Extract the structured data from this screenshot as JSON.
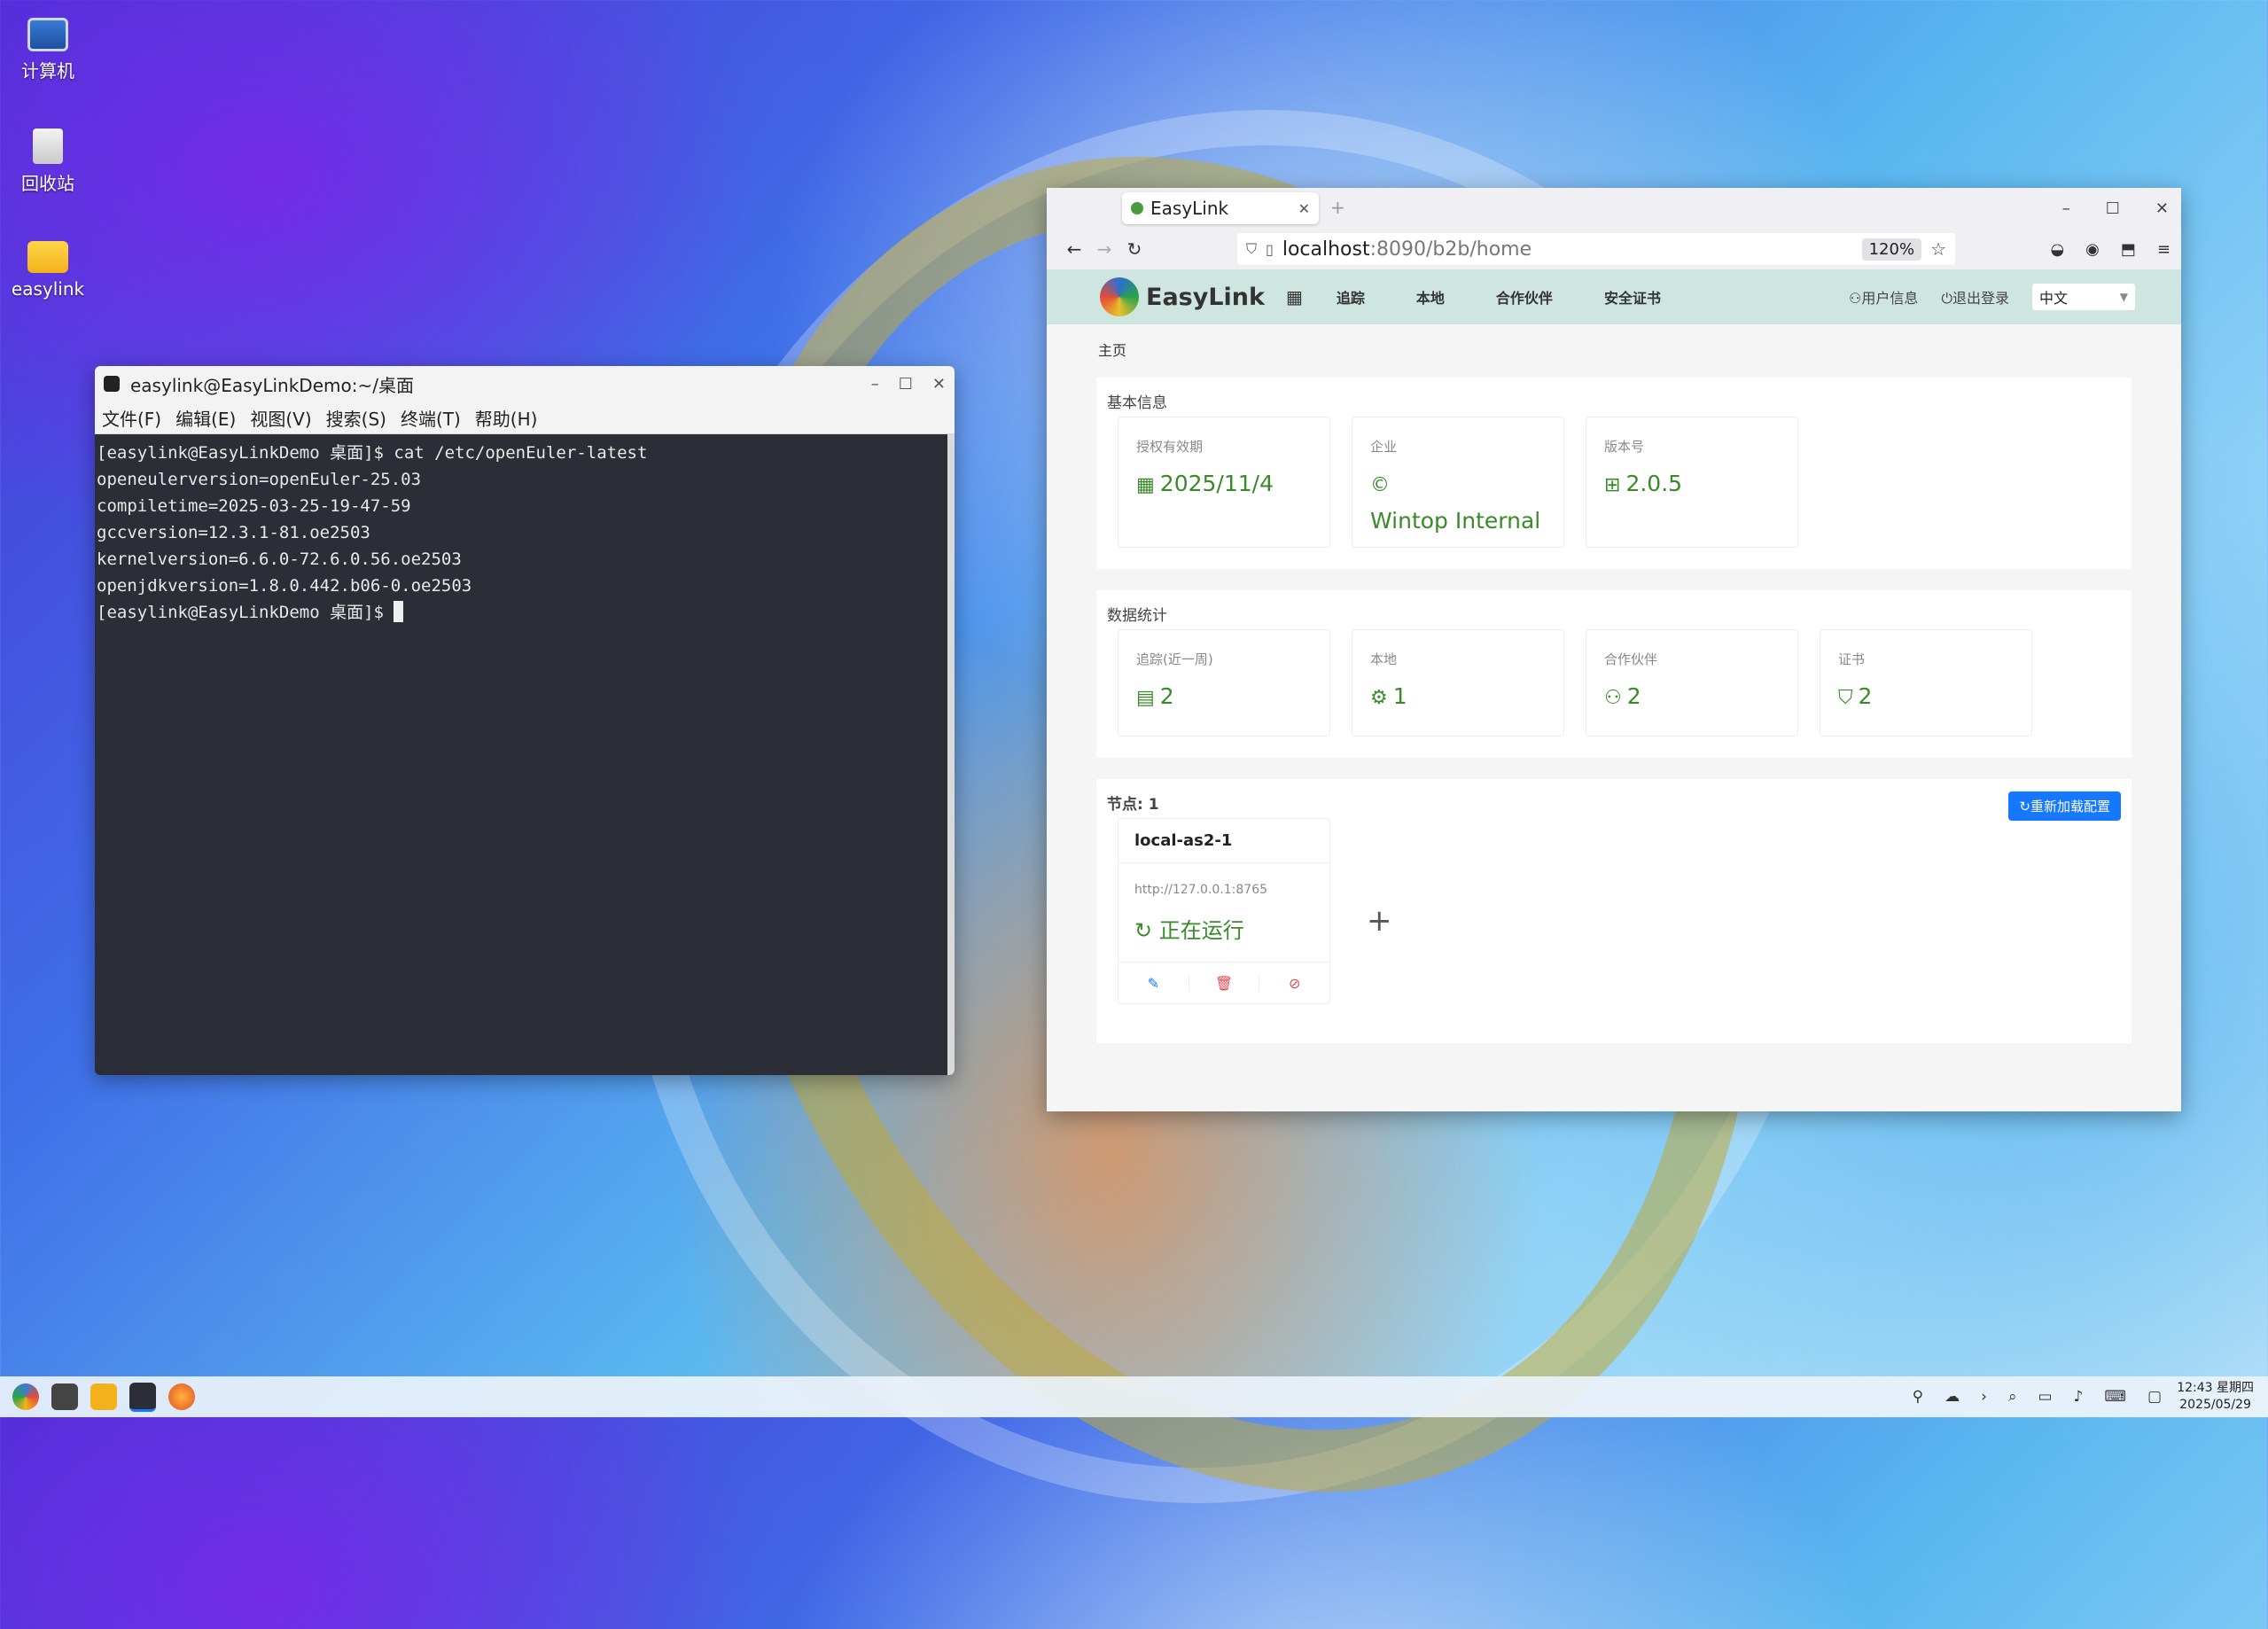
{
  "desktop": {
    "icons": [
      {
        "label": "计算机"
      },
      {
        "label": "回收站"
      },
      {
        "label": "easylink"
      }
    ]
  },
  "terminal": {
    "title": "easylink@EasyLinkDemo:~/桌面",
    "menu": [
      "文件(F)",
      "编辑(E)",
      "视图(V)",
      "搜索(S)",
      "终端(T)",
      "帮助(H)"
    ],
    "lines": [
      "[easylink@EasyLinkDemo 桌面]$ cat /etc/openEuler-latest",
      "openeulerversion=openEuler-25.03",
      "compiletime=2025-03-25-19-47-59",
      "gccversion=12.3.1-81.oe2503",
      "kernelversion=6.6.0-72.6.0.56.oe2503",
      "openjdkversion=1.8.0.442.b06-0.oe2503"
    ],
    "prompt": "[easylink@EasyLinkDemo 桌面]$ "
  },
  "browser": {
    "tab_title": "EasyLink",
    "url_host": "localhost",
    "url_path": ":8090/b2b/home",
    "zoom": "120%"
  },
  "app": {
    "brand": "EasyLink",
    "menu": [
      "追踪",
      "本地",
      "合作伙伴",
      "安全证书"
    ],
    "user_info": "用户信息",
    "logout": "退出登录",
    "language": "中文",
    "breadcrumb": "主页",
    "basic": {
      "title": "基本信息",
      "license_label": "授权有效期",
      "license_value": "2025/11/4",
      "company_label": "企业",
      "company_value": "Wintop Internal",
      "version_label": "版本号",
      "version_value": "2.0.5"
    },
    "stats": {
      "title": "数据统计",
      "items": [
        {
          "label": "追踪(近一周)",
          "value": "2"
        },
        {
          "label": "本地",
          "value": "1"
        },
        {
          "label": "合作伙伴",
          "value": "2"
        },
        {
          "label": "证书",
          "value": "2"
        }
      ]
    },
    "nodes": {
      "title": "节点: 1",
      "reload": "重新加载配置",
      "card": {
        "name": "local-as2-1",
        "url": "http://127.0.0.1:8765",
        "status": "正在运行"
      }
    }
  },
  "taskbar": {
    "time": "12:43 星期四",
    "date": "2025/05/29"
  }
}
